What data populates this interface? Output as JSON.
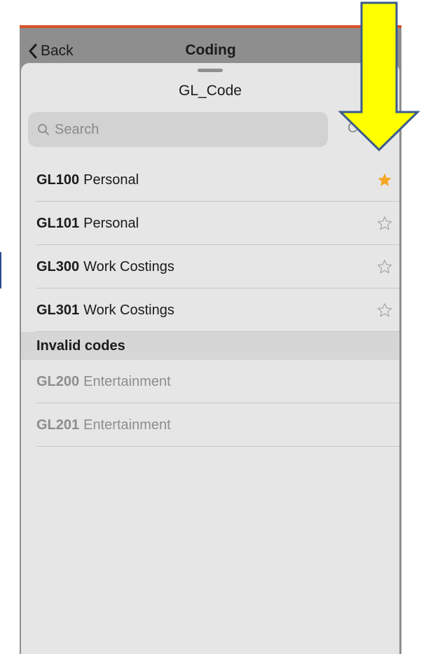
{
  "nav": {
    "back_label": "Back",
    "title": "Coding"
  },
  "sheet": {
    "title": "GL_Code"
  },
  "search": {
    "placeholder": "Search",
    "cancel_label": "Ca"
  },
  "valid_codes": [
    {
      "code": "GL100",
      "description": "Personal",
      "favorite": true
    },
    {
      "code": "GL101",
      "description": "Personal",
      "favorite": false
    },
    {
      "code": "GL300",
      "description": "Work Costings",
      "favorite": false
    },
    {
      "code": "GL301",
      "description": "Work Costings",
      "favorite": false
    }
  ],
  "invalid_section": {
    "header": "Invalid codes"
  },
  "invalid_codes": [
    {
      "code": "GL200",
      "description": "Entertainment"
    },
    {
      "code": "GL201",
      "description": "Entertainment"
    }
  ],
  "icons": {
    "back": "chevron-left-icon",
    "search": "magnifier-icon",
    "favorite_on": "star-filled-icon",
    "favorite_off": "star-outline-icon",
    "annotation": "down-arrow-icon"
  },
  "colors": {
    "accent_bar": "#d9532b",
    "star_filled": "#f5a623",
    "annotation_arrow_fill": "#ffff00",
    "annotation_arrow_stroke": "#3b5b8c"
  }
}
